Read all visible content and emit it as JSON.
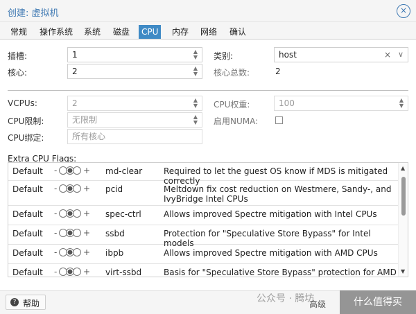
{
  "dialog": {
    "title": "创建: 虚拟机",
    "close_glyph": "×"
  },
  "tabs": [
    {
      "label": "常规"
    },
    {
      "label": "操作系统"
    },
    {
      "label": "系统"
    },
    {
      "label": "磁盘"
    },
    {
      "label": "CPU",
      "active": true
    },
    {
      "label": "内存"
    },
    {
      "label": "网络"
    },
    {
      "label": "确认"
    }
  ],
  "cpu": {
    "sockets_label": "插槽:",
    "sockets_value": "1",
    "cores_label": "核心:",
    "cores_value": "2",
    "type_label": "类别:",
    "type_value": "host",
    "total_cores_label": "核心总数:",
    "total_cores_value": "2",
    "vcpus_label": "VCPUs:",
    "vcpus_value": "2",
    "cpuunits_label": "CPU权重:",
    "cpuunits_value": "100",
    "cpulimit_label": "CPU限制:",
    "cpulimit_placeholder": "无限制",
    "numa_label": "启用NUMA:",
    "affinity_label": "CPU绑定:",
    "affinity_placeholder": "所有核心"
  },
  "flags": {
    "title": "Extra CPU Flags:",
    "rows": [
      {
        "state": "Default",
        "name": "md-clear",
        "desc": "Required to let the guest OS know if MDS is mitigated correctly"
      },
      {
        "state": "Default",
        "name": "pcid",
        "desc": "Meltdown fix cost reduction on Westmere, Sandy-, and IvyBridge Intel CPUs"
      },
      {
        "state": "Default",
        "name": "spec-ctrl",
        "desc": "Allows improved Spectre mitigation with Intel CPUs"
      },
      {
        "state": "Default",
        "name": "ssbd",
        "desc": "Protection for \"Speculative Store Bypass\" for Intel models"
      },
      {
        "state": "Default",
        "name": "ibpb",
        "desc": "Allows improved Spectre mitigation with AMD CPUs"
      },
      {
        "state": "Default",
        "name": "virt-ssbd",
        "desc": "Basis for \"Speculative Store Bypass\" protection for AMD models"
      }
    ],
    "minus": "-",
    "plus": "+"
  },
  "footer": {
    "help_label": "帮助",
    "advanced_label": "高级"
  },
  "watermark": {
    "text": "公众号 · 腾坊",
    "logo_text": "什么值得买"
  },
  "colors": {
    "accent": "#3f8ac5",
    "title": "#3f79b3"
  }
}
